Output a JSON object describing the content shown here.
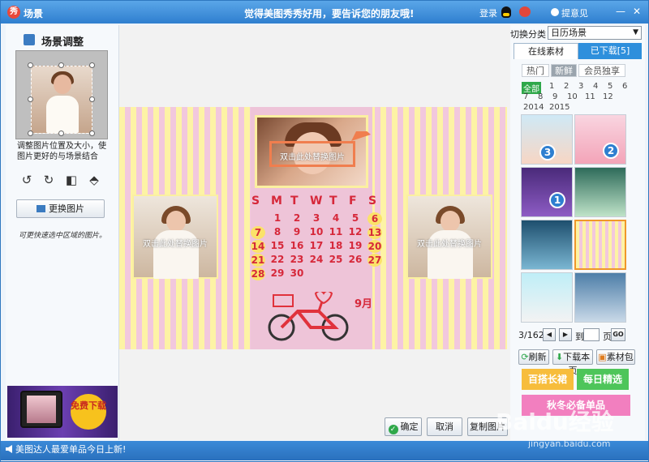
{
  "titlebar": {
    "app_title": "场景",
    "slogan": "觉得美图秀秀好用，要告诉您的朋友哦!",
    "login": "登录",
    "feedback": "提意见",
    "logo_glyph": "秀"
  },
  "left": {
    "title": "场景调整",
    "hint": "调整图片位置及大小，使图片更好的与场景结合",
    "change_button": "更换图片",
    "note": "可更快速选中区域的图片。",
    "ad_text": "免费下载"
  },
  "canvas": {
    "photo_label": "双击此处替换图片",
    "weekdays": [
      "S",
      "M",
      "T",
      "W",
      "T",
      "F",
      "S"
    ],
    "weeks": [
      [
        "",
        "1",
        "2",
        "3",
        "4",
        "5",
        "6"
      ],
      [
        "7",
        "8",
        "9",
        "10",
        "11",
        "12",
        "13"
      ],
      [
        "14",
        "15",
        "16",
        "17",
        "18",
        "19",
        "20"
      ],
      [
        "21",
        "22",
        "23",
        "24",
        "25",
        "26",
        "27"
      ],
      [
        "28",
        "29",
        "30",
        "",
        "",
        "",
        ""
      ]
    ],
    "month_label": "9月",
    "ok_button": "确定",
    "cancel_button": "取消",
    "copy_button": "复制图片"
  },
  "right": {
    "switch_label": "切换分类",
    "category": "日历场景",
    "tab_online": "在线素材",
    "tab_downloaded": "已下载[5]",
    "sub_tabs": [
      "热门",
      "新鲜",
      "会员独享"
    ],
    "filters": [
      "全部",
      "1",
      "2",
      "3",
      "4",
      "5",
      "6",
      "7",
      "8",
      "9",
      "10",
      "11",
      "12",
      "2014",
      "2015"
    ],
    "thumb_numbers": [
      "3",
      "2",
      "1"
    ],
    "page_info": "3/162",
    "goto_label": "到",
    "page_unit": "页",
    "go_button": "GO",
    "refresh": "刷新",
    "download_page": "下载本页",
    "library": "素材包",
    "promo1": "百搭长裙",
    "promo2": "每日精选",
    "promo3": "秋冬必备单品"
  },
  "status": {
    "text": "美图达人最爱单品今日上新!",
    "watermark": "Baidu经验",
    "watermark_url": "jingyan.baidu.com"
  },
  "colors": {
    "accent": "#2e8fdc",
    "calendar_red": "#d6283a",
    "highlight": "#f07e4e"
  }
}
